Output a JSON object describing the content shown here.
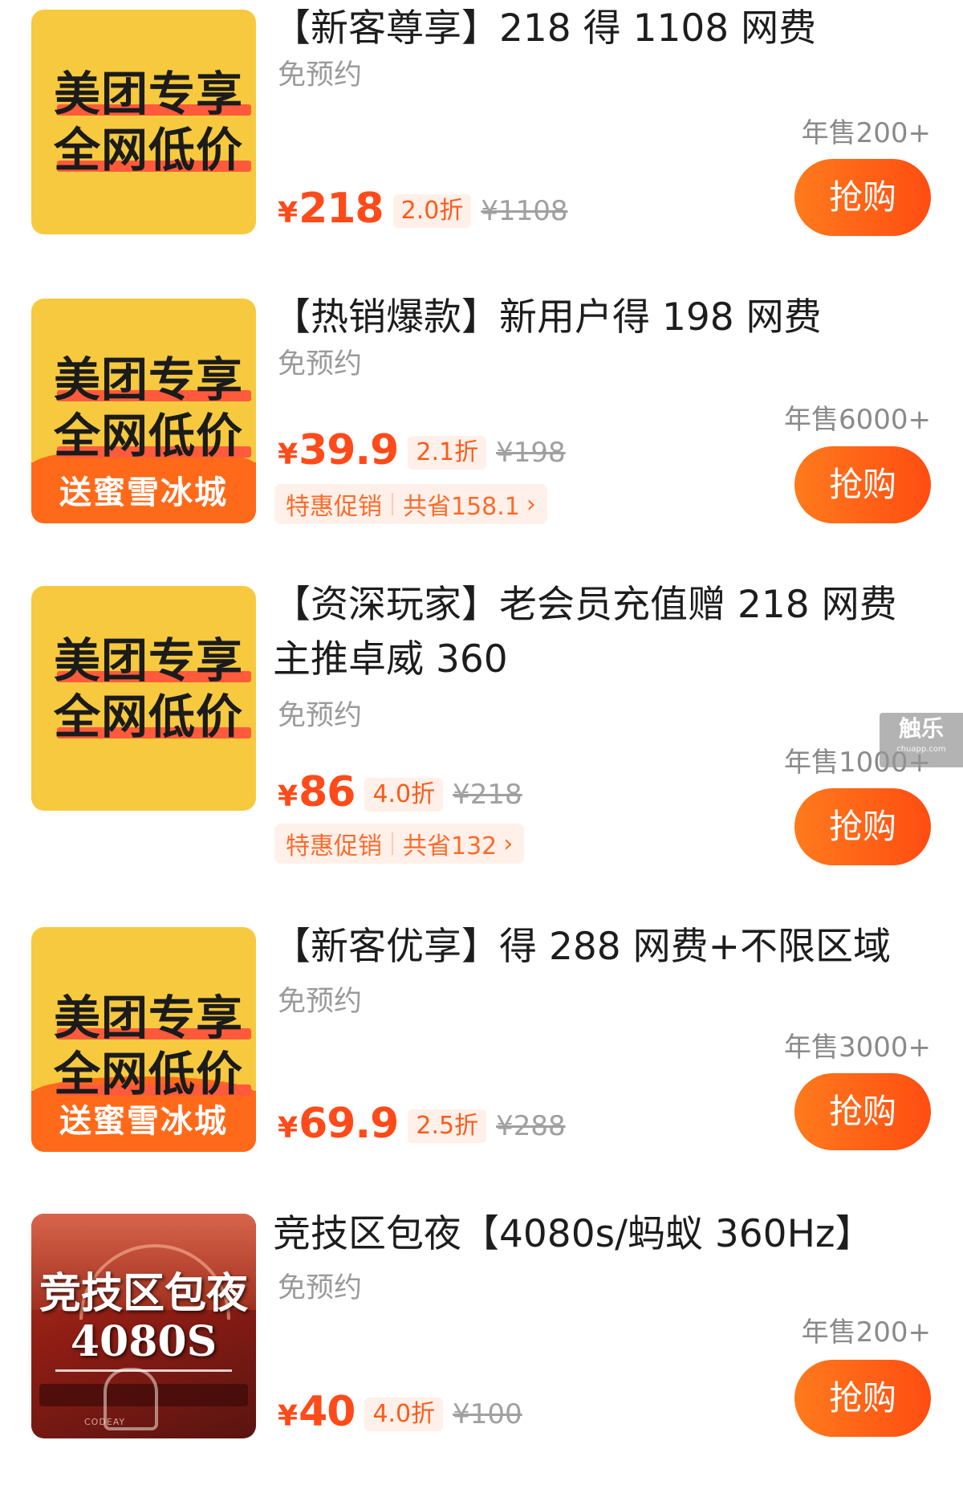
{
  "colors": {
    "accent": "#ff4a1a",
    "button_start": "#ff7a1c",
    "button_end": "#ff4d12",
    "thumb_yellow": "#f6c93f"
  },
  "watermark": {
    "name": "触乐",
    "site": "chuapp.com"
  },
  "items": [
    {
      "title": "【新客尊享】218 得 1108 网费",
      "thumb_line1": "美团专享",
      "thumb_line2": "全网低价",
      "reservation": "免预约",
      "sold": "年售200+",
      "currency": "¥",
      "price": "218",
      "discount": "2.0折",
      "original": "¥1108",
      "buy_label": "抢购"
    },
    {
      "title": "【热销爆款】新用户得 198 网费",
      "thumb_line1": "美团专享",
      "thumb_line2": "全网低价",
      "thumb_banner": "送蜜雪冰城",
      "reservation": "免预约",
      "sold": "年售6000+",
      "currency": "¥",
      "price": "39.9",
      "discount": "2.1折",
      "original": "¥198",
      "promo_label": "特惠促销",
      "promo_saving": "共省158.1",
      "buy_label": "抢购"
    },
    {
      "title": "【资深玩家】老会员充值赠 218 网费",
      "title_line2": "主推卓威 360",
      "thumb_line1": "美团专享",
      "thumb_line2": "全网低价",
      "reservation": "免预约",
      "sold": "年售1000+",
      "currency": "¥",
      "price": "86",
      "discount": "4.0折",
      "original": "¥218",
      "promo_label": "特惠促销",
      "promo_saving": "共省132",
      "buy_label": "抢购"
    },
    {
      "title": "【新客优享】得 288 网费+不限区域",
      "thumb_line1": "美团专享",
      "thumb_line2": "全网低价",
      "thumb_banner": "送蜜雪冰城",
      "reservation": "免预约",
      "sold": "年售3000+",
      "currency": "¥",
      "price": "69.9",
      "discount": "2.5折",
      "original": "¥288",
      "buy_label": "抢购"
    },
    {
      "title": "竞技区包夜【4080s/蚂蚁 360Hz】",
      "thumb_line1": "竞技区包夜",
      "thumb_line2": "4080S",
      "thumb_brand": "CODEAY",
      "reservation": "免预约",
      "sold": "年售200+",
      "currency": "¥",
      "price": "40",
      "discount": "4.0折",
      "original": "¥100",
      "buy_label": "抢购"
    }
  ]
}
